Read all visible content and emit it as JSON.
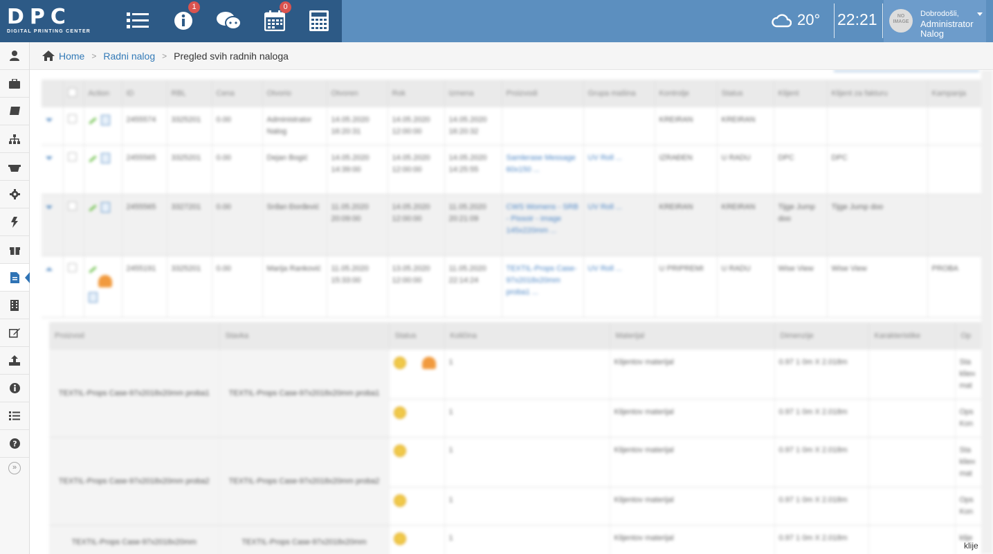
{
  "logo": {
    "main": "DPC",
    "sub": "DIGITAL PRINTING CENTER"
  },
  "topbar": {
    "icons": [
      {
        "name": "list-icon"
      },
      {
        "name": "info-icon",
        "badge": "1"
      },
      {
        "name": "chat-icon"
      },
      {
        "name": "calendar-icon",
        "badge": "0"
      },
      {
        "name": "calculator-icon"
      }
    ],
    "weather": {
      "icon": "cloud-icon",
      "temp": "20°"
    },
    "time": "22:21",
    "user": {
      "greeting": "Dobrodošli,",
      "name": "Administrator Nalog",
      "avatar_text": "NO IMAGE"
    }
  },
  "sidebar": {
    "items": [
      "user-icon",
      "briefcase-icon",
      "book-icon",
      "sitemap-icon",
      "basket-icon",
      "gear-icon",
      "bolt-icon",
      "gift-icon",
      "file-icon",
      "building-icon",
      "edit-icon",
      "upload-icon",
      "info-icon",
      "list-icon",
      "help-icon"
    ],
    "active_index": 8,
    "collapse_glyph": "»"
  },
  "breadcrumb": {
    "home": "Home",
    "section": "Radni nalog",
    "current": "Pregled svih radnih naloga"
  },
  "table": {
    "columns": [
      "",
      "",
      "Action",
      "ID",
      "RBL",
      "Cena",
      "Otvorio",
      "Otvoren",
      "Rok",
      "Izmena",
      "Proizvodi",
      "Grupa mašina",
      "Kontrolje",
      "Status",
      "Klijent",
      "Klijent za fakturu",
      "Kampanja"
    ],
    "rows": [
      {
        "id": "2455574",
        "rbl": "3325201",
        "cena": "0.00",
        "otvorio": "Administrator Nalog",
        "otvoren": "14.05.2020 16:20:31",
        "rok": "14.05.2020 12:00:00",
        "izmena": "14.05.2020 16:20:32",
        "proizvodi": "",
        "grupa": "",
        "kontrola": "KREIRAN",
        "status": "KREIRAN",
        "klijent": "",
        "klijent_faktura": "",
        "kampanja": ""
      },
      {
        "id": "2455565",
        "rbl": "3325201",
        "cena": "0.00",
        "otvorio": "Dejan Bogić",
        "otvoren": "14.05.2020 14:39:00",
        "rok": "14.05.2020 12:00:00",
        "izmena": "14.05.2020 14:25:55",
        "proizvodi": "Samlerase Message 60x150 ...",
        "grupa": "UV Roll ...",
        "kontrola": "IZRAĐEN",
        "status": "U RADU",
        "klijent": "DPC",
        "klijent_faktura": "DPC",
        "kampanja": ""
      },
      {
        "id": "2455565",
        "rbl": "3327201",
        "cena": "0.00",
        "otvorio": "Srđan Đorđević",
        "otvoren": "11.05.2020 20:09:00",
        "rok": "14.05.2020 12:00:00",
        "izmena": "11.05.2020 20:21:09",
        "proizvodi": "CWS Womens - SRB - Pissoir - image 145x220mm ...",
        "grupa": "UV Roll ...",
        "kontrola": "KREIRAN",
        "status": "KREIRAN",
        "klijent": "Tijge Jump doo",
        "klijent_faktura": "Tijge Jump doo",
        "kampanja": ""
      },
      {
        "id": "2455191",
        "rbl": "3325201",
        "cena": "0.00",
        "otvorio": "Marija Ranković",
        "otvoren": "11.05.2020 15:33:00",
        "rok": "13.05.2020 12:00:00",
        "izmena": "11.05.2020 22:14:24",
        "proizvodi": "TEXTIL-Props Case-97x2018x20mm proba1 ...",
        "grupa": "UV Roll ...",
        "kontrola": "U PRIPREMI",
        "status": "U RADU",
        "klijent": "Wise View",
        "klijent_faktura": "Wise View",
        "kampanja": "PROBA"
      }
    ]
  },
  "subtable": {
    "columns": [
      "Proizvod",
      "Stavka",
      "Status",
      "Količina",
      "Materijal",
      "Dimenzije",
      "Karakteristike",
      "Op"
    ],
    "groups": [
      {
        "proizvod": "TEXTIL-Props Case-97x2018x20mm proba1",
        "stavka": "TEXTIL-Props Case-97x2018x20mm proba1",
        "lines": [
          {
            "kolicina": "1",
            "materijal": "Klijentov materijal",
            "dimenzije": "0.97 1 0m X 2.018m",
            "op": "Sta kliен mat"
          },
          {
            "kolicina": "1",
            "materijal": "Klijentov materijal",
            "dimenzije": "0.97 1 0m X 2.018m",
            "op": "Ops Kon"
          }
        ]
      },
      {
        "proizvod": "TEXTIL-Props Case-97x2018x20mm proba2",
        "stavka": "TEXTIL-Props Case-97x2018x20mm proba2",
        "lines": [
          {
            "kolicina": "1",
            "materijal": "Klijentov materijal",
            "dimenzije": "0.97 1 0m X 2.018m",
            "op": "Sta kliен mat"
          },
          {
            "kolicina": "1",
            "materijal": "Klijentov materijal",
            "dimenzije": "0.97 1 0m X 2.018m",
            "op": "Ops Kon"
          }
        ]
      },
      {
        "proizvod": "TEXTIL-Props Case-97x2018x20mm",
        "stavka": "TEXTIL-Props Case-97x2018x20mm",
        "lines": [
          {
            "kolicina": "1",
            "materijal": "Klijentov materijal",
            "dimenzije": "0.97 1 0m X 2.018m",
            "op": "klije"
          }
        ]
      }
    ]
  },
  "cut_word": "klije"
}
